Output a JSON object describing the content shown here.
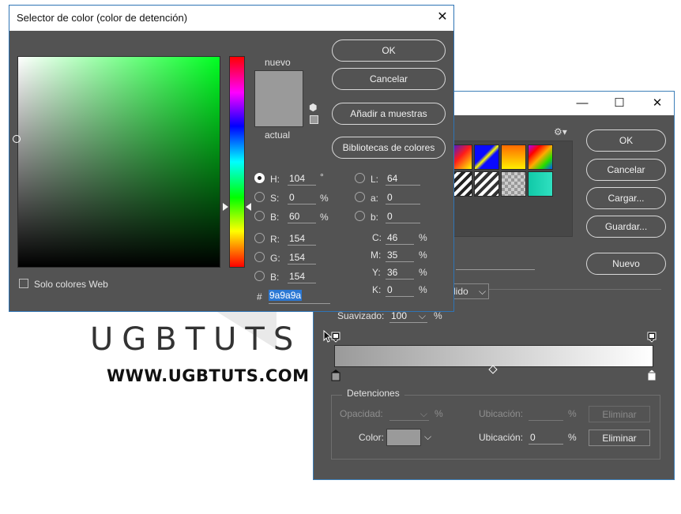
{
  "color_picker": {
    "title": "Selector de color (color de detención)",
    "buttons": {
      "ok": "OK",
      "cancel": "Cancelar",
      "add_to_swatches": "Añadir a muestras",
      "color_libraries": "Bibliotecas de colores"
    },
    "preview": {
      "new_label": "nuevo",
      "current_label": "actual",
      "color": "#9a9a9a"
    },
    "web_only": {
      "label": "Solo colores Web",
      "checked": false
    },
    "hsb": {
      "h": {
        "label": "H:",
        "value": "104",
        "unit": "°",
        "selected": true
      },
      "s": {
        "label": "S:",
        "value": "0",
        "unit": "%",
        "selected": false
      },
      "b": {
        "label": "B:",
        "value": "60",
        "unit": "%",
        "selected": false
      }
    },
    "rgb": {
      "r": {
        "label": "R:",
        "value": "154"
      },
      "g": {
        "label": "G:",
        "value": "154"
      },
      "b": {
        "label": "B:",
        "value": "154"
      }
    },
    "lab": {
      "l": {
        "label": "L:",
        "value": "64"
      },
      "a": {
        "label": "a:",
        "value": "0"
      },
      "b": {
        "label": "b:",
        "value": "0"
      }
    },
    "cmyk": {
      "c": {
        "label": "C:",
        "value": "46",
        "unit": "%"
      },
      "m": {
        "label": "M:",
        "value": "35",
        "unit": "%"
      },
      "y": {
        "label": "Y:",
        "value": "36",
        "unit": "%"
      },
      "k": {
        "label": "K:",
        "value": "0",
        "unit": "%"
      }
    },
    "hex": {
      "label": "#",
      "value": "9a9a9a"
    }
  },
  "gradient_editor": {
    "buttons": {
      "ok": "OK",
      "cancel": "Cancelar",
      "load": "Cargar...",
      "save": "Guardar...",
      "new": "Nuevo"
    },
    "gradient_type_partial": "lido",
    "smoothness": {
      "label": "Suavizado:",
      "value": "100",
      "unit": "%"
    },
    "stops": {
      "group_label": "Detenciones",
      "opacity_label": "Opacidad:",
      "opacity_unit": "%",
      "location_label": "Ubicación:",
      "location_unit": "%",
      "delete_label": "Eliminar",
      "color_label": "Color:",
      "color_location_value": "0",
      "stop_color": "#9a9a9a"
    }
  },
  "watermark": {
    "title": "UGBTUTS",
    "url": "WWW.UGBTUTS.COM"
  }
}
